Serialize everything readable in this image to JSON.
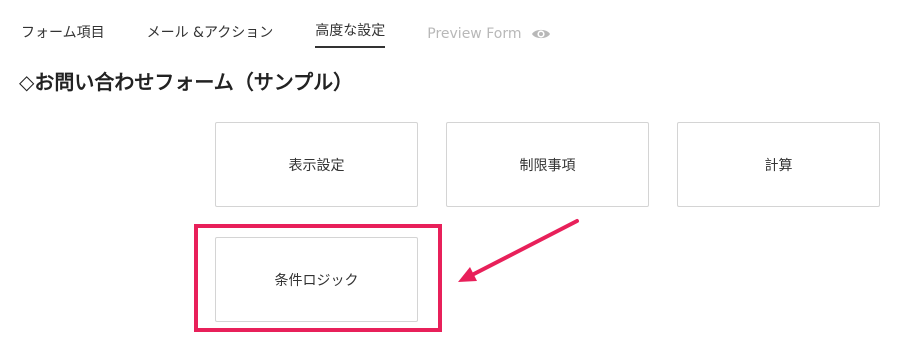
{
  "tabs": [
    {
      "label": "フォーム項目"
    },
    {
      "label": "メール &アクション"
    },
    {
      "label": "高度な設定"
    },
    {
      "label": "Preview Form"
    }
  ],
  "form_title": "◇お問い合わせフォーム（サンプル）",
  "cards": {
    "display": "表示設定",
    "limits": "制限事項",
    "calc": "計算",
    "logic": "条件ロジック"
  },
  "colors": {
    "highlight": "#e8205a",
    "active_tab_underline": "#333333",
    "disabled_tab": "#b8b8b8"
  },
  "icons": {
    "preview": "eye-icon",
    "annotation": "arrow-annotation"
  }
}
